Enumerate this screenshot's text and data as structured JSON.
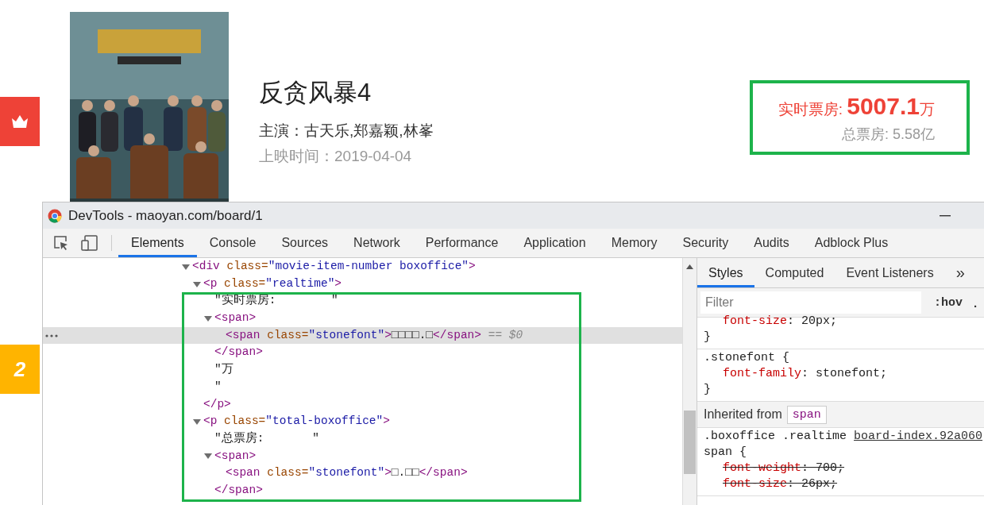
{
  "page": {
    "rank_badges": [
      {
        "kind": "crown",
        "color": "#ee4237"
      },
      {
        "kind": "number",
        "text": "2",
        "color": "#ffb400"
      }
    ],
    "movie": {
      "title": "反贪风暴4",
      "cast": "主演：古天乐,郑嘉颖,林峯",
      "release": "上映时间：2019-04-04"
    },
    "boxoffice": {
      "realtime_label": "实时票房: ",
      "realtime_value": "5007.1",
      "realtime_unit": "万",
      "total": "总票房: 5.58亿"
    }
  },
  "devtools": {
    "title": "DevTools - maoyan.com/board/1",
    "tabs": [
      {
        "label": "Elements",
        "selected": true
      },
      {
        "label": "Console",
        "selected": false
      },
      {
        "label": "Sources",
        "selected": false
      },
      {
        "label": "Network",
        "selected": false
      },
      {
        "label": "Performance",
        "selected": false
      },
      {
        "label": "Application",
        "selected": false
      },
      {
        "label": "Memory",
        "selected": false
      },
      {
        "label": "Security",
        "selected": false
      },
      {
        "label": "Audits",
        "selected": false
      },
      {
        "label": "Adblock Plus",
        "selected": false
      }
    ],
    "elements": {
      "nodes": [
        {
          "selected": false,
          "expanded": true,
          "tokens": [
            {
              "kind": "tag",
              "text": "<div"
            },
            {
              "kind": "attr",
              "text": " class="
            },
            {
              "kind": "value",
              "text": "\"movie-item-number boxoffice\""
            },
            {
              "kind": "tag",
              "text": ">"
            }
          ],
          "children": [
            {
              "selected": false,
              "expanded": true,
              "tokens": [
                {
                  "kind": "tag",
                  "text": "<p"
                },
                {
                  "kind": "attr",
                  "text": " class="
                },
                {
                  "kind": "value",
                  "text": "\"realtime\""
                },
                {
                  "kind": "tag",
                  "text": ">"
                }
              ],
              "children": [
                {
                  "selected": false,
                  "lines": [
                    "\"实时票房:        \""
                  ]
                },
                {
                  "selected": false,
                  "expanded": true,
                  "tokens": [
                    {
                      "kind": "tag",
                      "text": "<span>"
                    }
                  ],
                  "children": [
                    {
                      "selected": true,
                      "tokens": [
                        {
                          "kind": "tag",
                          "text": "<span"
                        },
                        {
                          "kind": "attr",
                          "text": " class="
                        },
                        {
                          "kind": "value",
                          "text": "\"stonefont\""
                        },
                        {
                          "kind": "tag",
                          "text": ">"
                        },
                        {
                          "kind": "text",
                          "text": "□□□□.□"
                        },
                        {
                          "kind": "tag",
                          "text": "</span>"
                        },
                        {
                          "kind": "hint",
                          "text": " == $0"
                        }
                      ]
                    }
                  ],
                  "close": [
                    {
                      "kind": "tag",
                      "text": "</span>"
                    }
                  ]
                },
                {
                  "selected": false,
                  "lines": [
                    "\"万",
                    "\""
                  ]
                }
              ],
              "close": [
                {
                  "kind": "tag",
                  "text": "</p>"
                }
              ]
            },
            {
              "selected": false,
              "expanded": true,
              "tokens": [
                {
                  "kind": "tag",
                  "text": "<p"
                },
                {
                  "kind": "attr",
                  "text": " class="
                },
                {
                  "kind": "value",
                  "text": "\"total-boxoffice\""
                },
                {
                  "kind": "tag",
                  "text": ">"
                }
              ],
              "children": [
                {
                  "selected": false,
                  "lines": [
                    "\"总票房:       \""
                  ]
                },
                {
                  "selected": false,
                  "expanded": true,
                  "tokens": [
                    {
                      "kind": "tag",
                      "text": "<span>"
                    }
                  ],
                  "children": [
                    {
                      "selected": false,
                      "tokens": [
                        {
                          "kind": "tag",
                          "text": "<span"
                        },
                        {
                          "kind": "attr",
                          "text": " class="
                        },
                        {
                          "kind": "value",
                          "text": "\"stonefont\""
                        },
                        {
                          "kind": "tag",
                          "text": ">"
                        },
                        {
                          "kind": "text",
                          "text": "□.□□"
                        },
                        {
                          "kind": "tag",
                          "text": "</span>"
                        }
                      ]
                    }
                  ],
                  "close": [
                    {
                      "kind": "tag",
                      "text": "</span>"
                    }
                  ]
                }
              ]
            }
          ]
        }
      ]
    },
    "styles": {
      "tabs": [
        {
          "label": "Styles",
          "selected": true
        },
        {
          "label": "Computed",
          "selected": false
        },
        {
          "label": "Event Listeners",
          "selected": false
        }
      ],
      "more": "»",
      "filter": {
        "placeholder": "Filter"
      },
      "hov": ":hov",
      "cls": ".",
      "sections": [
        {
          "kind": "rule",
          "declarations": [
            {
              "property": "font-size",
              "value": ": 20px;",
              "overridden": false
            }
          ],
          "close": "}"
        },
        {
          "kind": "rule",
          "selector_lines": [
            ".stonefont {"
          ],
          "declarations": [
            {
              "property": "font-family",
              "value": ": stonefont;",
              "overridden": false
            }
          ],
          "close": "}"
        },
        {
          "kind": "inherited",
          "label": "Inherited from",
          "tag": "span"
        },
        {
          "kind": "rule",
          "selector_lines": [
            ".boxoffice .realtime",
            "span {"
          ],
          "source": "board-index.92a060",
          "declarations": [
            {
              "property": "font-weight",
              "value": ": 700;",
              "overridden": true
            },
            {
              "property": "font-size",
              "value": ": 26px;",
              "overridden": true
            }
          ]
        }
      ]
    }
  }
}
